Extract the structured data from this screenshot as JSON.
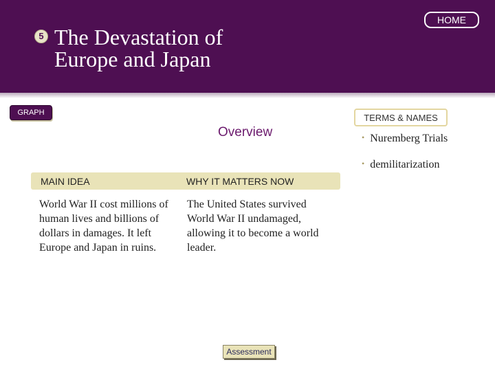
{
  "header": {
    "section_number": "5",
    "title_line1": "The Devastation of",
    "title_line2": "Europe and Japan",
    "home_label": "HOME"
  },
  "graph_label": "GRAPH",
  "overview_label": "Overview",
  "terms": {
    "header": "TERMS & NAMES",
    "items": [
      "Nuremberg Trials",
      "demilitarization"
    ]
  },
  "band": {
    "main_idea_label": "MAIN IDEA",
    "why_label": "WHY IT MATTERS NOW"
  },
  "main_idea_text": "World War II cost millions of human lives and billions of dollars in damages. It left Europe and Japan in ruins.",
  "why_text": "The United States survived World War II undamaged, allowing it to become a world leader.",
  "assessment_label": "Assessment",
  "colors": {
    "header_bg": "#4e0f52",
    "band_bg": "#e9e3b8",
    "overview_text": "#6b1a6d"
  }
}
